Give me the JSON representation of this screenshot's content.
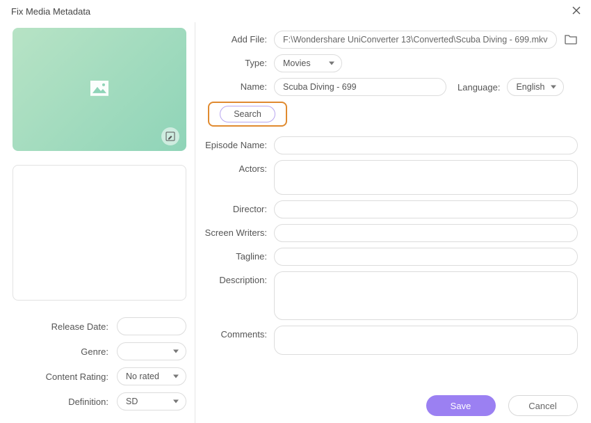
{
  "window": {
    "title": "Fix Media Metadata"
  },
  "left": {
    "release_date_label": "Release Date:",
    "release_date_value": "",
    "genre_label": "Genre:",
    "genre_value": "",
    "content_rating_label": "Content Rating:",
    "content_rating_value": "No rated",
    "definition_label": "Definition:",
    "definition_value": "SD"
  },
  "right": {
    "add_file_label": "Add File:",
    "add_file_value": "F:\\Wondershare UniConverter 13\\Converted\\Scuba Diving - 699.mkv",
    "type_label": "Type:",
    "type_value": "Movies",
    "name_label": "Name:",
    "name_value": "Scuba Diving - 699",
    "language_label": "Language:",
    "language_value": "English",
    "search_label": "Search",
    "episode_name_label": "Episode Name:",
    "episode_name_value": "",
    "actors_label": "Actors:",
    "actors_value": "",
    "director_label": "Director:",
    "director_value": "",
    "screen_writers_label": "Screen Writers:",
    "screen_writers_value": "",
    "tagline_label": "Tagline:",
    "tagline_value": "",
    "description_label": "Description:",
    "description_value": "",
    "comments_label": "Comments:",
    "comments_value": ""
  },
  "footer": {
    "save_label": "Save",
    "cancel_label": "Cancel"
  }
}
